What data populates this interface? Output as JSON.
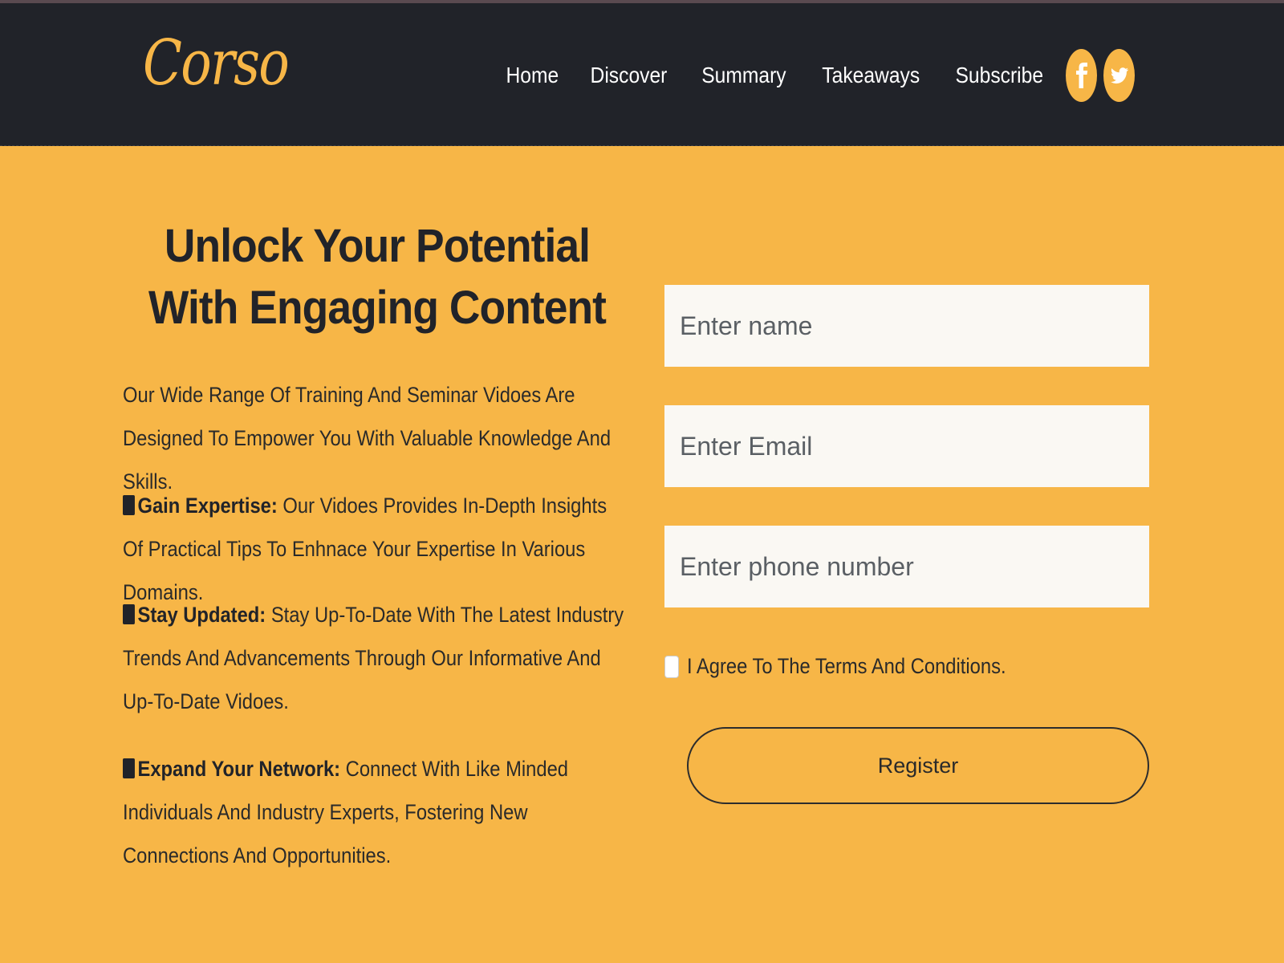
{
  "brand": {
    "logo_text": "Corso",
    "accent_color": "#f7b647",
    "nav_bg": "#212329"
  },
  "nav": {
    "items": [
      {
        "label": "Home"
      },
      {
        "label": "Discover"
      },
      {
        "label": "Summary"
      },
      {
        "label": "Takeaways"
      },
      {
        "label": "Subscribe"
      }
    ],
    "social": [
      {
        "icon": "facebook-icon"
      },
      {
        "icon": "twitter-icon"
      }
    ]
  },
  "hero": {
    "headline": "Unlock Your Potential With Engaging Content",
    "intro": "Our Wide Range Of Training And Seminar Vidoes Are Designed To Empower You With Valuable Knowledge And Skills.",
    "features": [
      {
        "title": "Gain Expertise:",
        "text": " Our Vidoes Provides In-Depth Insights Of Practical Tips To Enhnace Your Expertise In Various Domains."
      },
      {
        "title": "Stay Updated:",
        "text": " Stay Up-To-Date With The Latest Industry Trends And Advancements Through Our Informative And Up-To-Date Vidoes."
      },
      {
        "title": "Expand Your Network:",
        "text": " Connect With Like Minded Individuals And Industry Experts, Fostering New Connections And Opportunities."
      }
    ]
  },
  "form": {
    "name_placeholder": "Enter name",
    "email_placeholder": "Enter Email",
    "phone_placeholder": "Enter phone number",
    "agree_label": "I Agree To The Terms And Conditions.",
    "register_label": "Register"
  }
}
